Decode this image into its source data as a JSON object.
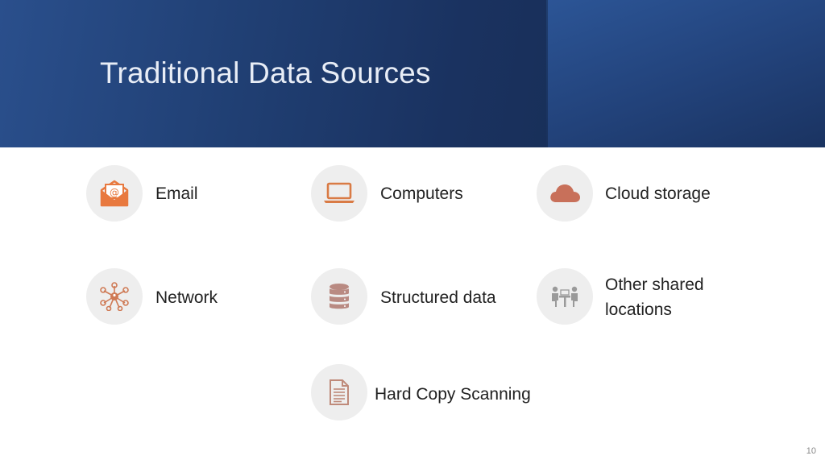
{
  "slide": {
    "title": "Traditional Data Sources",
    "page_number": "10"
  },
  "items": [
    {
      "label": "Email",
      "icon": "email-icon",
      "icon_color": "#e8793f"
    },
    {
      "label": "Computers",
      "icon": "laptop-icon",
      "icon_color": "#d97b45"
    },
    {
      "label": "Cloud storage",
      "icon": "cloud-icon",
      "icon_color": "#c8705a"
    },
    {
      "label": "Network",
      "icon": "network-icon",
      "icon_color": "#cf7a55"
    },
    {
      "label": "Structured data",
      "icon": "database-icon",
      "icon_color": "#b98a82"
    },
    {
      "label": "Other shared locations",
      "icon": "meeting-icon",
      "icon_color": "#9a9a9a"
    },
    {
      "label": "Hard Copy Scanning",
      "icon": "document-icon",
      "icon_color": "#bf8a7a"
    }
  ],
  "colors": {
    "header": "#1f3d70",
    "circle": "#eeeeee",
    "text": "#222222"
  }
}
